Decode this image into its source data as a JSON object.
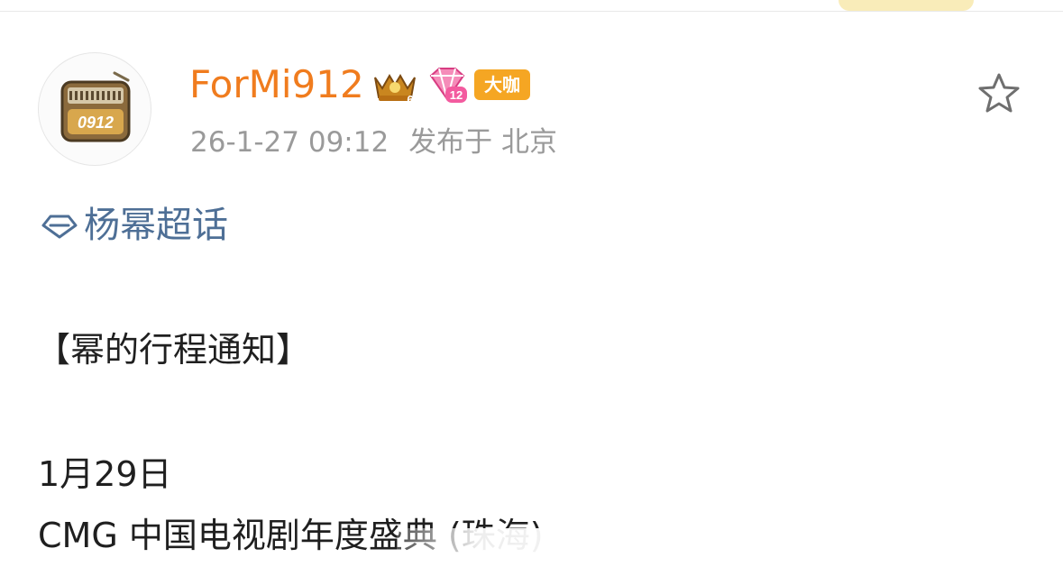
{
  "post": {
    "author": {
      "name": "ForMi912",
      "avatar_text": "0912",
      "badges": {
        "crown_level": "6",
        "diamond_level": "12",
        "label": "大咖"
      }
    },
    "timestamp": "26-1-27 09:12",
    "location": "发布于 北京",
    "topic": "杨幂超话",
    "lines": [
      "【幂的行程通知】",
      "1月29日",
      "CMG 中国电视剧年度盛典 (珠海)"
    ]
  },
  "colors": {
    "username": "#f07c1e",
    "meta": "#9a9a9a",
    "topic": "#4e6f96",
    "badge": "#f5a623",
    "text": "#1f1f1f"
  },
  "icons": {
    "star": "star-icon",
    "diamond": "topic-diamond-icon",
    "radio": "radio-avatar-icon"
  }
}
